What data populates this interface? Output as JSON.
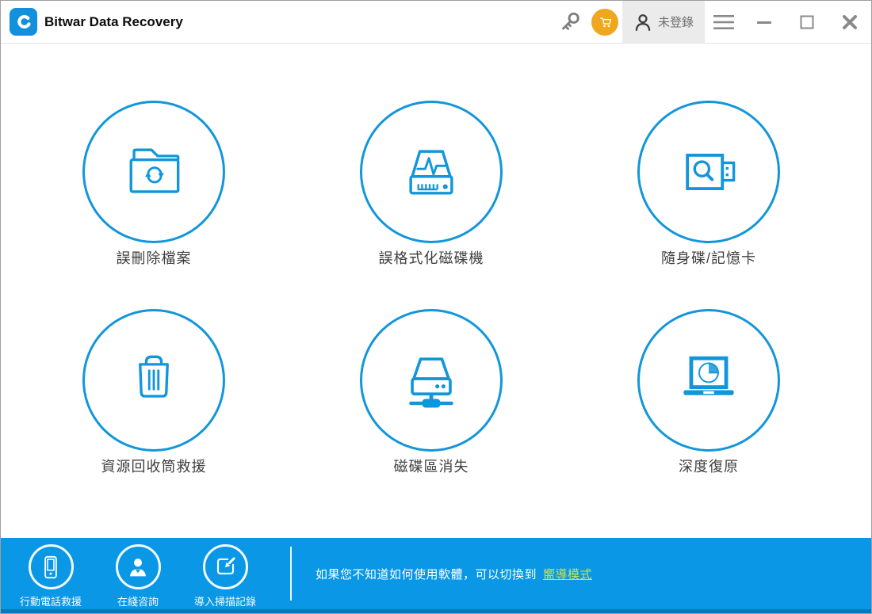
{
  "titlebar": {
    "app_title": "Bitwar Data Recovery",
    "login_label": "未登錄",
    "icons": [
      "app-logo-icon",
      "key-icon",
      "cart-icon",
      "user-icon",
      "hamburger-icon",
      "minimize-icon",
      "maximize-icon",
      "close-icon"
    ]
  },
  "features": [
    {
      "label": "誤刪除檔案",
      "icon": "folder-recycle-icon"
    },
    {
      "label": "誤格式化磁碟機",
      "icon": "drive-pulse-icon"
    },
    {
      "label": "隨身碟/記憶卡",
      "icon": "usb-search-icon"
    },
    {
      "label": "資源回收筒救援",
      "icon": "trash-icon"
    },
    {
      "label": "磁碟區消失",
      "icon": "drive-network-icon"
    },
    {
      "label": "深度復原",
      "icon": "laptop-pie-icon"
    }
  ],
  "footer": {
    "actions": [
      {
        "label": "行動電話救援",
        "icon": "mobile-phone-icon"
      },
      {
        "label": "在綫咨詢",
        "icon": "support-person-icon"
      },
      {
        "label": "導入掃描記錄",
        "icon": "import-scan-icon"
      }
    ],
    "hint_text": "如果您不知道如何使用軟體，可以切換到",
    "hint_link": "嚮導模式"
  },
  "colors": {
    "brand_blue": "#1296db",
    "footer_blue": "#0a97e5",
    "footer_strip": "#0779bb",
    "cart_orange": "#efa71d",
    "link_green": "#cfe14d"
  }
}
